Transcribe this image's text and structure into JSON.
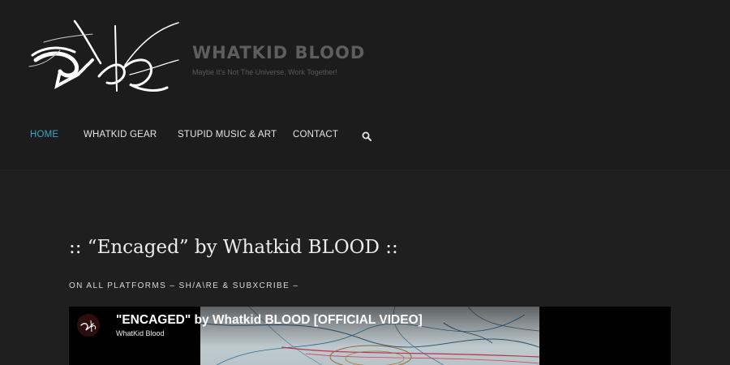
{
  "site": {
    "title": "WHATKID BLOOD",
    "tagline": "Maybe It's Not The Universe, Work Together!"
  },
  "nav": {
    "items": [
      {
        "label": "HOME",
        "active": true
      },
      {
        "label": "WHATKID GEAR",
        "active": false
      },
      {
        "label": "STUPID MUSIC & ART",
        "active": false
      },
      {
        "label": "CONTACT",
        "active": false
      }
    ],
    "search_icon": "search-icon",
    "active_color": "#3aa6c8"
  },
  "post": {
    "title": ":: “Encaged” by Whatkid BLOOD ::",
    "subtitle": "ON ALL PLATFORMS – SH/A\\RE & SUBXCRIBE –"
  },
  "video": {
    "title": "\"ENCAGED\" by Whatkid BLOOD [OFFICIAL VIDEO]",
    "channel": "WhatKid Blood"
  }
}
